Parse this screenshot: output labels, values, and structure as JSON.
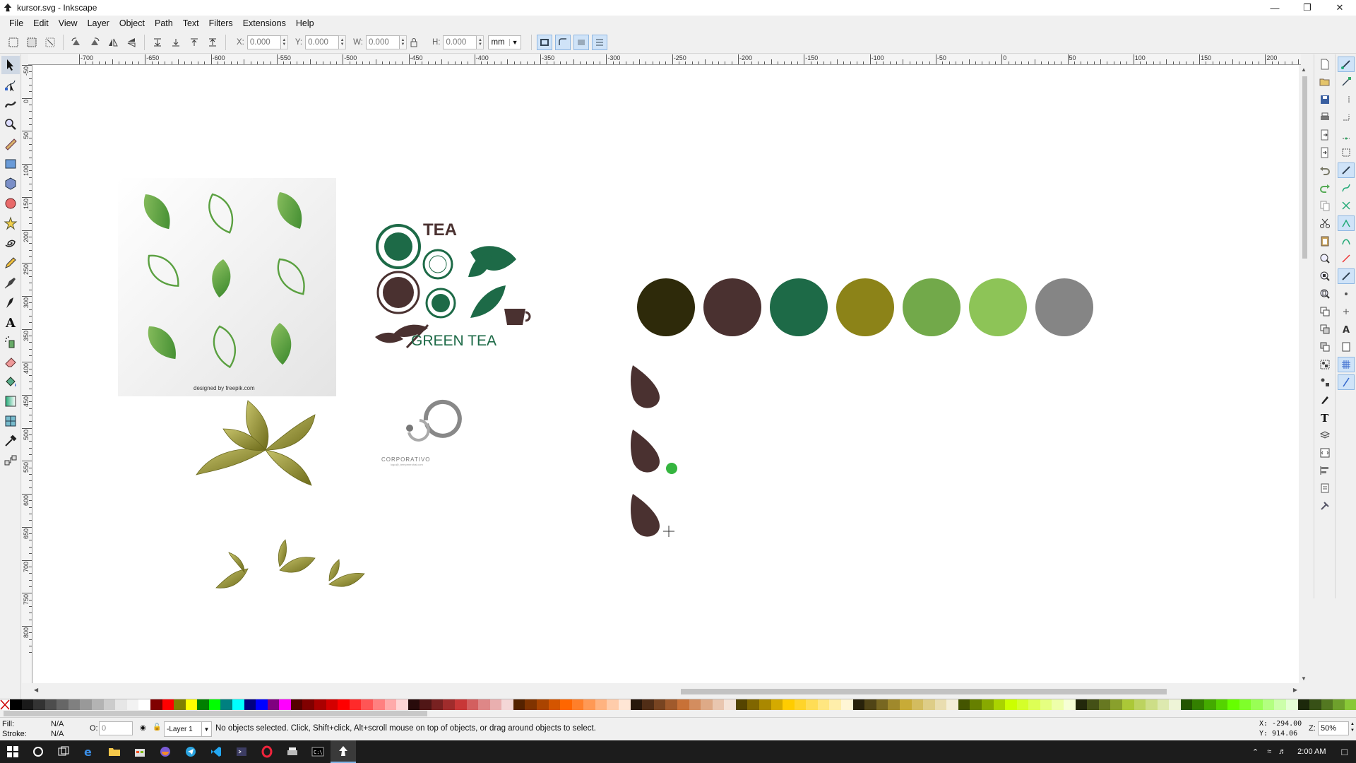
{
  "window": {
    "title": "kursor.svg - Inkscape",
    "minimize_icon": "minimize-icon",
    "restore_icon": "restore-icon",
    "close_icon": "close-icon"
  },
  "menu": [
    "File",
    "Edit",
    "View",
    "Layer",
    "Object",
    "Path",
    "Text",
    "Filters",
    "Extensions",
    "Help"
  ],
  "toolcontrols": {
    "x_label": "X:",
    "x_value": "0.000",
    "y_label": "Y:",
    "y_value": "0.000",
    "w_label": "W:",
    "w_value": "0.000",
    "h_label": "H:",
    "h_value": "0.000",
    "unit": "mm"
  },
  "rulers": {
    "h_labels": [
      "-700",
      "-650",
      "-600",
      "-550",
      "-500",
      "-450",
      "-400",
      "-350",
      "-300",
      "-250",
      "-200",
      "-150",
      "-100",
      "-50",
      "0",
      "50",
      "100",
      "150",
      "200"
    ],
    "v_labels": [
      "-50",
      "0",
      "50",
      "100",
      "150",
      "200",
      "250",
      "300",
      "350",
      "400",
      "450",
      "500",
      "550",
      "600",
      "650",
      "700",
      "750",
      "800"
    ]
  },
  "canvas": {
    "tea_logo": {
      "title_text": "TEA",
      "bottom_text": "GREEN TEA"
    },
    "leaves_card": {
      "credit_text": "designed by  freepik.com"
    },
    "corporate_logo": {
      "text": "CORPORATIVO",
      "subtext": "logo@_tempmerohai.com"
    },
    "color_circles": [
      "#2e2a0a",
      "#4a3130",
      "#1d6a47",
      "#8c8318",
      "#72a94a",
      "#8dc457",
      "#858585"
    ],
    "cursor_leaf_color": "#4a3130",
    "indicator_dot_color": "#35b53f"
  },
  "palette_colors": [
    "#000000",
    "#1a1a1a",
    "#333333",
    "#4d4d4d",
    "#666666",
    "#808080",
    "#999999",
    "#b3b3b3",
    "#cccccc",
    "#e6e6e6",
    "#f2f2f2",
    "#ffffff",
    "#800000",
    "#ff0000",
    "#808000",
    "#ffff00",
    "#008000",
    "#00ff00",
    "#008080",
    "#00ffff",
    "#000080",
    "#0000ff",
    "#800080",
    "#ff00ff",
    "#550000",
    "#800000",
    "#aa0000",
    "#d40000",
    "#ff0000",
    "#ff2a2a",
    "#ff5555",
    "#ff8080",
    "#ffaaaa",
    "#ffd5d5",
    "#280b0b",
    "#501616",
    "#782121",
    "#a02c2c",
    "#c83737",
    "#d35f5f",
    "#de8787",
    "#e9afaf",
    "#f4d7d7",
    "#552200",
    "#803300",
    "#aa4400",
    "#d45500",
    "#ff6600",
    "#ff7f2a",
    "#ff9955",
    "#ffb380",
    "#ffccaa",
    "#ffe6d5",
    "#28170b",
    "#502d16",
    "#784421",
    "#a05a2c",
    "#c87137",
    "#d38d5f",
    "#deaa87",
    "#e9c6af",
    "#f4e3d7",
    "#554400",
    "#806600",
    "#aa8800",
    "#d4aa00",
    "#ffcc00",
    "#ffd42a",
    "#ffdd55",
    "#ffe680",
    "#ffeeaa",
    "#fff6d5",
    "#28220b",
    "#504416",
    "#786721",
    "#a0892c",
    "#c8ab37",
    "#d3bc5f",
    "#decd87",
    "#e9ddaf",
    "#f4eed7",
    "#445500",
    "#668000",
    "#88aa00",
    "#aad400",
    "#ccff00",
    "#d4ff2a",
    "#ddff55",
    "#e5ff80",
    "#eeffaa",
    "#f6ffd5",
    "#22280b",
    "#445016",
    "#677821",
    "#89a02c",
    "#abc837",
    "#bcd35f",
    "#cdde87",
    "#dde9af",
    "#eef4d7",
    "#225500",
    "#338000",
    "#44aa00",
    "#55d400",
    "#66ff00",
    "#7fff2a",
    "#99ff55",
    "#b3ff80",
    "#ccffaa",
    "#e5ffd5",
    "#1c280b",
    "#375016",
    "#537821",
    "#6ea02c",
    "#89c837"
  ],
  "status": {
    "fill_label": "Fill:",
    "fill_value": "N/A",
    "stroke_label": "Stroke:",
    "stroke_value": "N/A",
    "opacity_label": "O:",
    "opacity_value": "0",
    "layer": "-Layer 1",
    "message": "No objects selected. Click, Shift+click, Alt+scroll mouse on top of objects, or drag around objects to select.",
    "x_coord": "X: -294.00",
    "y_coord": "Y: 914.06",
    "zoom_label": "Z:",
    "zoom": "50%"
  },
  "taskbar": {
    "time": "2:00 AM"
  }
}
